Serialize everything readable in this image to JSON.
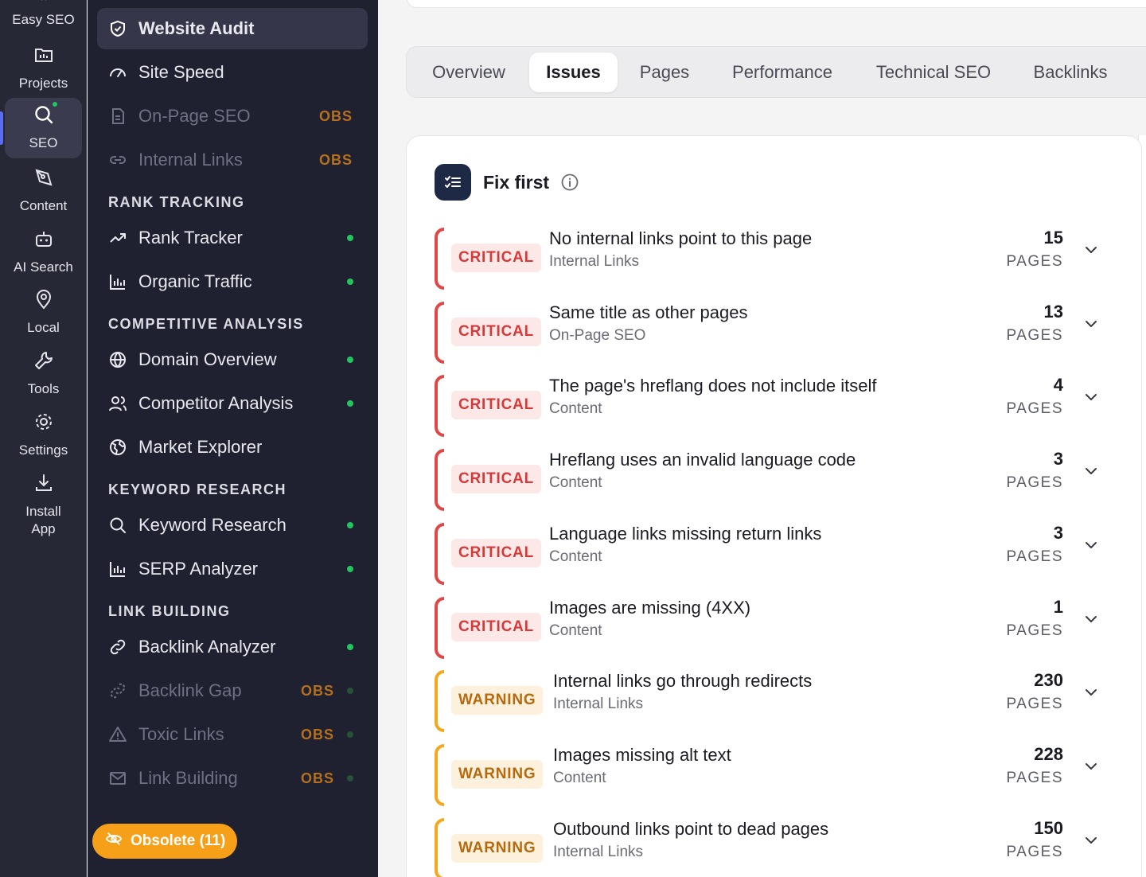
{
  "rail": {
    "items": [
      {
        "label": "Easy SEO",
        "icon": "logo-icon"
      },
      {
        "label": "Projects",
        "icon": "folder-icon"
      },
      {
        "label": "SEO",
        "icon": "search-icon"
      },
      {
        "label": "Content",
        "icon": "pen-icon"
      },
      {
        "label": "AI Search",
        "icon": "robot-icon"
      },
      {
        "label": "Local",
        "icon": "map-pin-icon"
      },
      {
        "label": "Tools",
        "icon": "wrench-icon"
      },
      {
        "label": "Settings",
        "icon": "gear-icon"
      },
      {
        "label": "Install App",
        "icon": "download-icon"
      }
    ]
  },
  "sidebar": {
    "top_items": [
      {
        "label": "Website Audit",
        "icon": "shield-icon"
      },
      {
        "label": "Site Speed",
        "icon": "gauge-icon"
      },
      {
        "label": "On-Page SEO",
        "icon": "document-icon",
        "tag": "OBS"
      },
      {
        "label": "Internal Links",
        "icon": "link-icon",
        "tag": "OBS"
      }
    ],
    "sections": {
      "rank_tracking": "RANK TRACKING",
      "competitive_analysis": "COMPETITIVE ANALYSIS",
      "keyword_research": "KEYWORD RESEARCH",
      "link_building": "LINK BUILDING"
    },
    "rank_items": [
      {
        "label": "Rank Tracker",
        "icon": "trend-up-icon"
      },
      {
        "label": "Organic Traffic",
        "icon": "bar-chart-icon"
      }
    ],
    "competitive_items": [
      {
        "label": "Domain Overview",
        "icon": "globe-icon"
      },
      {
        "label": "Competitor Analysis",
        "icon": "users-icon"
      },
      {
        "label": "Market Explorer",
        "icon": "world-icon"
      }
    ],
    "keyword_items": [
      {
        "label": "Keyword Research",
        "icon": "search-icon"
      },
      {
        "label": "SERP Analyzer",
        "icon": "bar-chart-icon"
      }
    ],
    "link_items": [
      {
        "label": "Backlink Analyzer",
        "icon": "link-icon"
      },
      {
        "label": "Backlink Gap",
        "icon": "broken-link-icon",
        "tag": "OBS"
      },
      {
        "label": "Toxic Links",
        "icon": "warning-icon",
        "tag": "OBS"
      },
      {
        "label": "Link Building",
        "icon": "mail-icon",
        "tag": "OBS"
      }
    ],
    "obsolete_button": "Obsolete (11)"
  },
  "tabs": [
    "Overview",
    "Issues",
    "Pages",
    "Performance",
    "Technical SEO",
    "Backlinks"
  ],
  "active_tab": "Issues",
  "fix_first": {
    "title": "Fix first",
    "unit": "PAGES",
    "issues": [
      {
        "severity": "CRITICAL",
        "title": "No internal links point to this page",
        "category": "Internal Links",
        "count": "15"
      },
      {
        "severity": "CRITICAL",
        "title": "Same title as other pages",
        "category": "On-Page SEO",
        "count": "13"
      },
      {
        "severity": "CRITICAL",
        "title": "The page's hreflang does not include itself",
        "category": "Content",
        "count": "4"
      },
      {
        "severity": "CRITICAL",
        "title": "Hreflang uses an invalid language code",
        "category": "Content",
        "count": "3"
      },
      {
        "severity": "CRITICAL",
        "title": "Language links missing return links",
        "category": "Content",
        "count": "3"
      },
      {
        "severity": "CRITICAL",
        "title": "Images are missing (4XX)",
        "category": "Content",
        "count": "1"
      },
      {
        "severity": "WARNING",
        "title": "Internal links go through redirects",
        "category": "Internal Links",
        "count": "230"
      },
      {
        "severity": "WARNING",
        "title": "Images missing alt text",
        "category": "Content",
        "count": "228"
      },
      {
        "severity": "WARNING",
        "title": "Outbound links point to dead pages",
        "category": "Internal Links",
        "count": "150"
      }
    ]
  },
  "colors": {
    "critical": "#d43a3a",
    "warning": "#b56a0d",
    "obsolete": "#f6a01a",
    "online_dot": "#22c55e"
  }
}
